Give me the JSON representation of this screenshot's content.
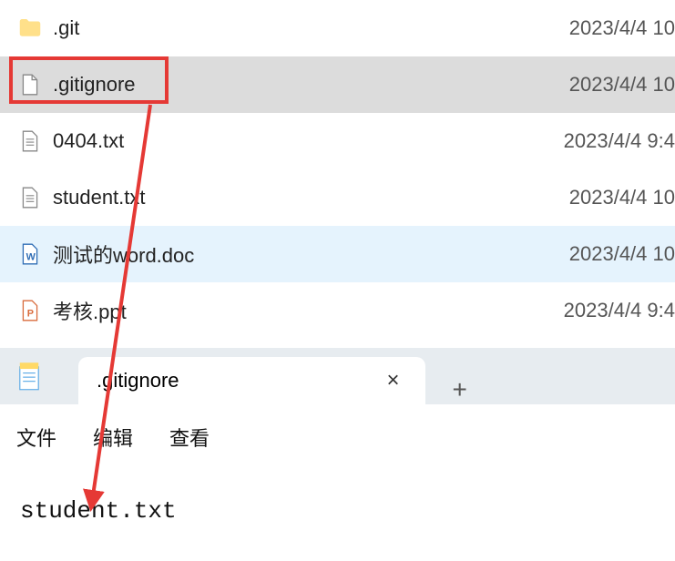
{
  "files": [
    {
      "name": ".git",
      "date": "2023/4/4 10",
      "type": "folder",
      "state": ""
    },
    {
      "name": ".gitignore",
      "date": "2023/4/4 10",
      "type": "file",
      "state": "selected"
    },
    {
      "name": "0404.txt",
      "date": "2023/4/4 9:4",
      "type": "txt",
      "state": ""
    },
    {
      "name": "student.txt",
      "date": "2023/4/4 10",
      "type": "txt",
      "state": ""
    },
    {
      "name": "测试的word.doc",
      "date": "2023/4/4 10",
      "type": "doc",
      "state": "hover"
    },
    {
      "name": "考核.ppt",
      "date": "2023/4/4 9:4",
      "type": "ppt",
      "state": ""
    }
  ],
  "editor": {
    "tab_title": ".gitignore",
    "menus": {
      "file": "文件",
      "edit": "编辑",
      "view": "查看"
    },
    "content": "student.txt"
  },
  "icons": {
    "close": "×",
    "plus": "+"
  }
}
